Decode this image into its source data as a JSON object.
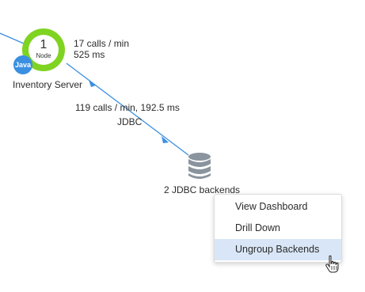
{
  "node": {
    "count": "1",
    "sublabel": "Node",
    "badge": "Java",
    "name": "Inventory Server",
    "calls": "17 calls / min",
    "response": "525 ms"
  },
  "edge": {
    "stats": "119 calls / min, 192.5 ms",
    "protocol": "JDBC"
  },
  "backend": {
    "label": "2 JDBC backends",
    "icon": "database-icon"
  },
  "context_menu": {
    "items": [
      {
        "label": "View Dashboard"
      },
      {
        "label": "Drill Down"
      },
      {
        "label": "Ungroup Backends"
      }
    ],
    "selected_index": 2
  },
  "colors": {
    "node_ring": "#7fd321",
    "java_badge": "#3b8fe0",
    "edge": "#3b8fe0",
    "menu_highlight": "#d8e6f7",
    "database": "#8a949e"
  }
}
